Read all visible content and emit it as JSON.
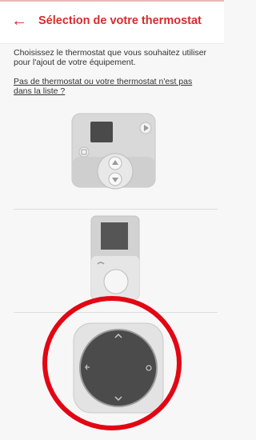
{
  "header": {
    "back_icon": "arrow-left-icon",
    "title": "Sélection de votre thermostat",
    "accent_color": "#d62c2c"
  },
  "content": {
    "intro_text": "Choisissez le thermostat que vous souhaitez utiliser pour l'ajout de votre équipement.",
    "not_listed_link": "Pas de thermostat ou votre thermostat n'est pas dans la liste ?"
  },
  "thermostats": [
    {
      "name": "thermostat-rectangular-with-arrows"
    },
    {
      "name": "thermostat-vertical-with-dial"
    },
    {
      "name": "thermostat-round-dial"
    }
  ],
  "highlight": {
    "color": "#e30613"
  }
}
